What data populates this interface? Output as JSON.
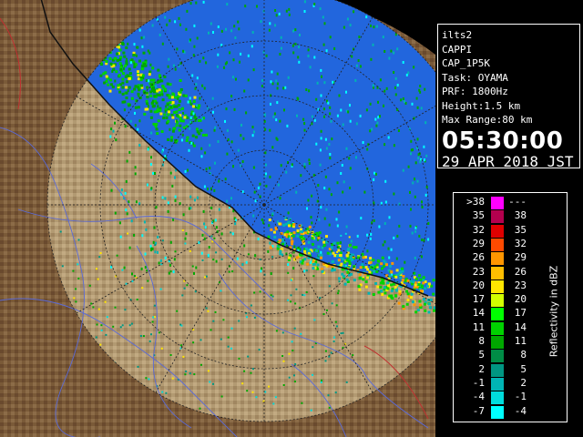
{
  "info": {
    "station": "ilts2",
    "product": "CAPPI",
    "scan": "CAP_1P5K",
    "task": "Task: OYAMA",
    "prf": "PRF: 1800Hz",
    "height": "Height:1.5 km",
    "max_range": "Max Range:80 km",
    "time": "05:30:00",
    "date": "29 APR 2018 JST"
  },
  "legend": {
    "unit_label": "Reflectivity in dBZ",
    "rows": [
      {
        "lo": ">38",
        "hi": "---",
        "color": "#ff00ff"
      },
      {
        "lo": "35",
        "hi": "38",
        "color": "#b4004e"
      },
      {
        "lo": "32",
        "hi": "35",
        "color": "#e00000"
      },
      {
        "lo": "29",
        "hi": "32",
        "color": "#ff4a00"
      },
      {
        "lo": "26",
        "hi": "29",
        "color": "#ff9600"
      },
      {
        "lo": "23",
        "hi": "26",
        "color": "#ffbe00"
      },
      {
        "lo": "20",
        "hi": "23",
        "color": "#ffe600"
      },
      {
        "lo": "17",
        "hi": "20",
        "color": "#d2ff00"
      },
      {
        "lo": "14",
        "hi": "17",
        "color": "#00ff00"
      },
      {
        "lo": "11",
        "hi": "14",
        "color": "#00d200"
      },
      {
        "lo": "8",
        "hi": "11",
        "color": "#00a800"
      },
      {
        "lo": "5",
        "hi": "8",
        "color": "#008c46"
      },
      {
        "lo": "2",
        "hi": "5",
        "color": "#009682"
      },
      {
        "lo": "-1",
        "hi": "2",
        "color": "#00b4b4"
      },
      {
        "lo": "-4",
        "hi": "-1",
        "color": "#00dcdc"
      },
      {
        "lo": "-7",
        "hi": "-4",
        "color": "#00ffff"
      }
    ]
  },
  "colors": {
    "sea": "#2266dd",
    "land": "#7a5a38",
    "range_ring": "#222222"
  }
}
